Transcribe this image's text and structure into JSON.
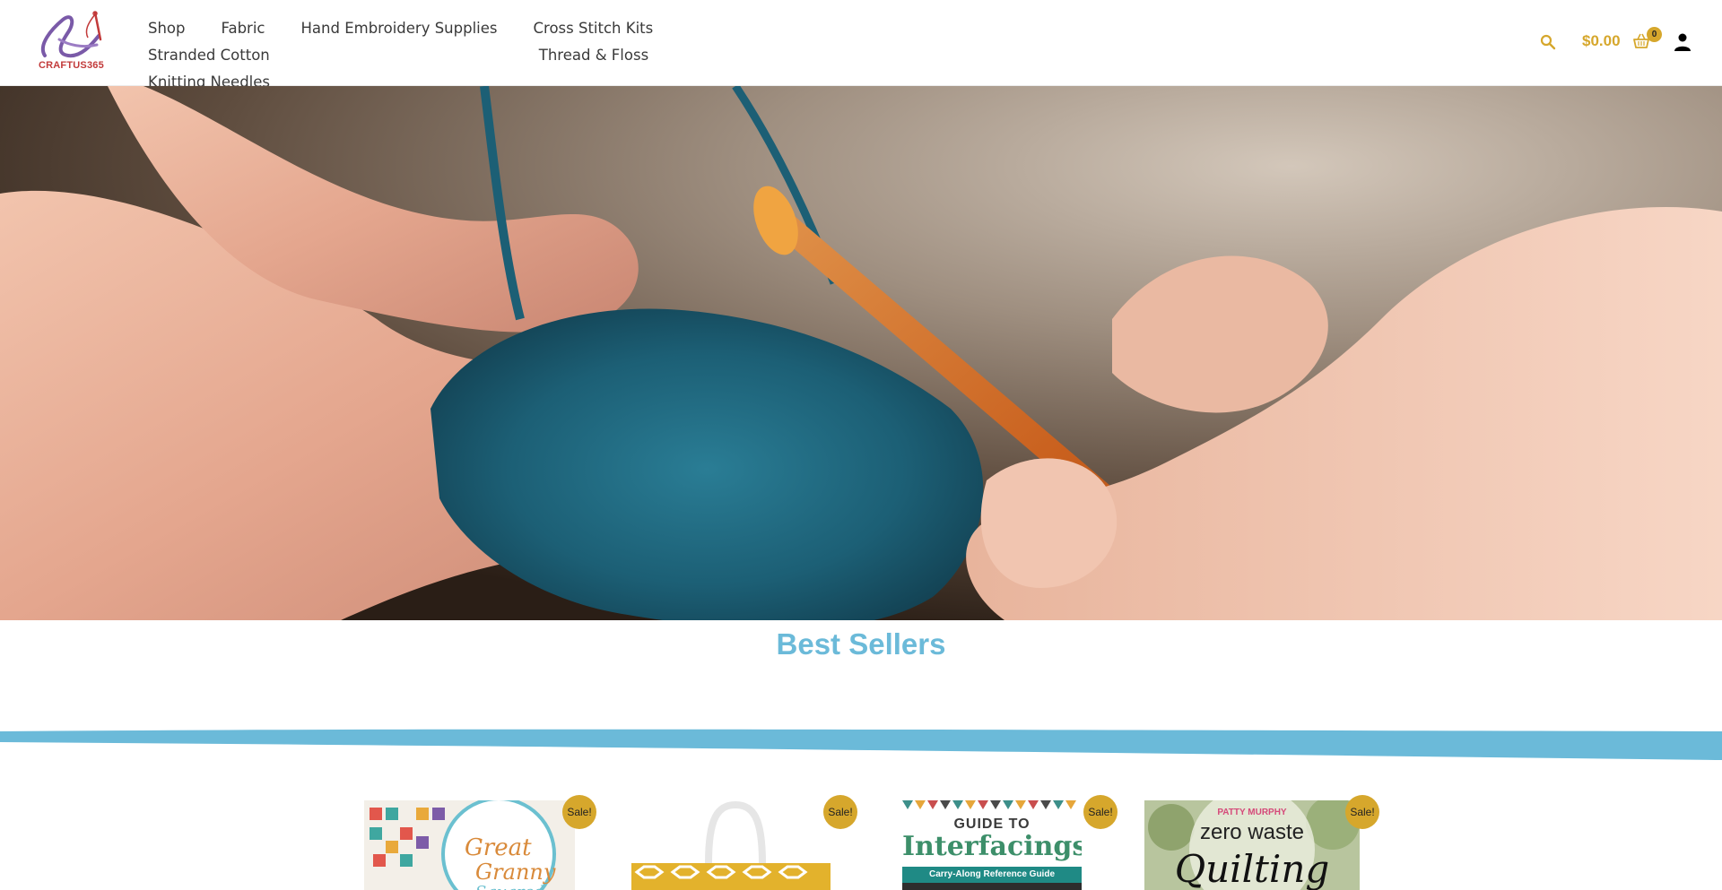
{
  "brand": {
    "name": "CRAFTUS365"
  },
  "nav": {
    "items": [
      {
        "label": "Shop"
      },
      {
        "label": "Fabric"
      },
      {
        "label": "Hand Embroidery Supplies"
      },
      {
        "label": "Cross Stitch Kits"
      },
      {
        "label": "Stranded Cotton"
      },
      {
        "label": "Thread & Floss"
      },
      {
        "label": "Knitting Needles"
      }
    ]
  },
  "header": {
    "search_icon": "search-icon",
    "cart_total": "$0.00",
    "cart_count": "0",
    "cart_icon": "basket-icon",
    "account_icon": "user-icon"
  },
  "hero": {
    "image": "hands-crocheting-blue-yarn-photo"
  },
  "best_sellers": {
    "title": "Best Sellers",
    "products": [
      {
        "badge": "Sale!",
        "cover_line1": "Great",
        "cover_line2": "Granny",
        "cover_line3": "Squared"
      },
      {
        "badge": "Sale!"
      },
      {
        "badge": "Sale!",
        "cover_line1": "GUIDE TO",
        "cover_line2": "Interfacings",
        "cover_line3": "Carry-Along Reference Guide"
      },
      {
        "badge": "Sale!",
        "cover_line1": "PATTY MURPHY",
        "cover_line2": "zero waste",
        "cover_line3": "Quilting"
      }
    ]
  },
  "colors": {
    "accent_gold": "#d6a72c",
    "heading_blue": "#6bbad9",
    "logo_purple": "#7a5aa8",
    "logo_red": "#c23a3a"
  }
}
